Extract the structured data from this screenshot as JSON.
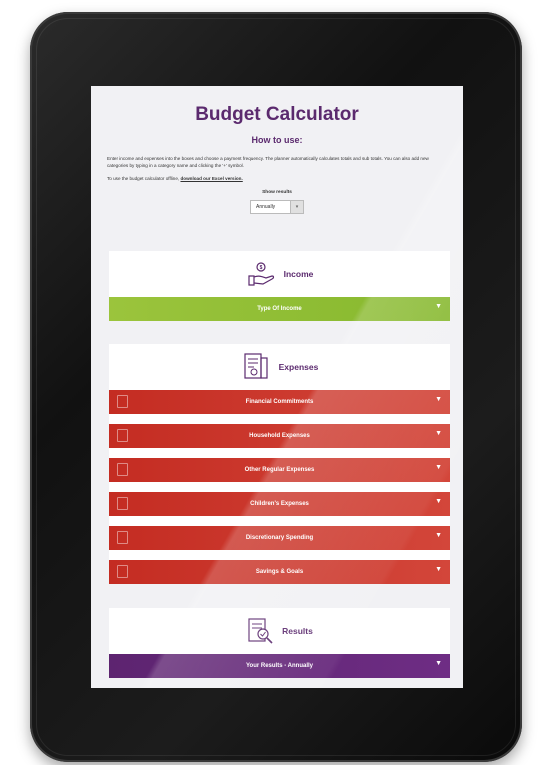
{
  "page": {
    "title": "Budget Calculator",
    "howto_heading": "How to use:",
    "instructions": "Enter income and expenses into the boxes and choose a payment frequency. The planner automatically calculates totals and sub totals. You can also add new categories by typing in a category name and clicking the '+' symbol.",
    "offline_text": "To use the budget calculator offline, ",
    "offline_link": "download our Excel version.",
    "show_results_label": "Show results",
    "frequency_value": "Annually"
  },
  "income": {
    "heading": "Income",
    "rows": [
      {
        "label": "Type Of Income"
      }
    ]
  },
  "expenses": {
    "heading": "Expenses",
    "rows": [
      {
        "label": "Financial Commitments"
      },
      {
        "label": "Household Expenses"
      },
      {
        "label": "Other Regular Expenses"
      },
      {
        "label": "Children's Expenses"
      },
      {
        "label": "Discretionary Spending"
      },
      {
        "label": "Savings & Goals"
      }
    ]
  },
  "results": {
    "heading": "Results",
    "rows": [
      {
        "label": "Your Results - Annually"
      }
    ]
  },
  "colors": {
    "brand_purple": "#5b2a6e",
    "income_green": "#8fbe34",
    "expense_red": "#c9372c",
    "results_purple": "#622879"
  }
}
